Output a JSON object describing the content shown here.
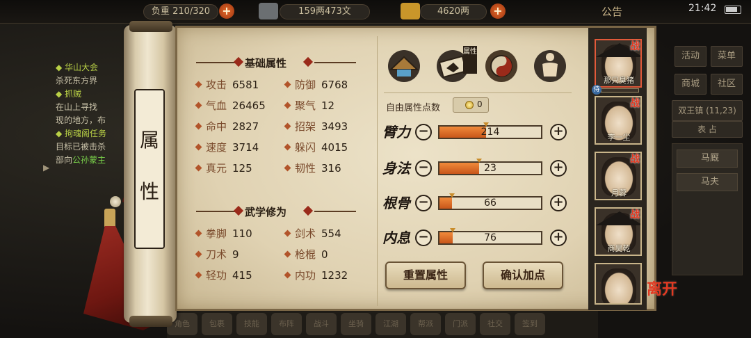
{
  "status": {
    "time": "21:42"
  },
  "topbar": {
    "carry_label": "负重",
    "carry": "210/320",
    "money_text": "159两473文",
    "gold": "4620两",
    "notice": "公告",
    "plus": "+"
  },
  "quest": {
    "items": [
      {
        "title": "华山大会",
        "desc": "杀死东方界"
      },
      {
        "title": "抓贼",
        "desc": "在山上寻找",
        "desc2": "现的地方，布"
      },
      {
        "title": "拘魂阁任务",
        "desc": "目标已被击杀",
        "desc2": "部向",
        "highlight": "公孙蒙主"
      }
    ]
  },
  "right_menu": {
    "buttons": [
      "活动",
      "菜单",
      "商城",
      "社区"
    ],
    "location": "双王镇",
    "coords": "(11,23)",
    "sub": "表 占",
    "items": [
      "马厩",
      "马夫"
    ]
  },
  "scroll_title": [
    "属",
    "性"
  ],
  "basic": {
    "title": "基础属性",
    "attrs": [
      {
        "name": "攻击",
        "value": "6581"
      },
      {
        "name": "防御",
        "value": "6768"
      },
      {
        "name": "气血",
        "value": "26465"
      },
      {
        "name": "聚气",
        "value": "12"
      },
      {
        "name": "命中",
        "value": "2827"
      },
      {
        "name": "招架",
        "value": "3493"
      },
      {
        "name": "速度",
        "value": "3714"
      },
      {
        "name": "躲闪",
        "value": "4015"
      },
      {
        "name": "真元",
        "value": "125"
      },
      {
        "name": "韧性",
        "value": "316"
      }
    ]
  },
  "martial": {
    "title": "武学修为",
    "attrs": [
      {
        "name": "拳脚",
        "value": "110"
      },
      {
        "name": "剑术",
        "value": "554"
      },
      {
        "name": "刀术",
        "value": "9"
      },
      {
        "name": "枪棍",
        "value": "0"
      },
      {
        "name": "轻功",
        "value": "415"
      },
      {
        "name": "内功",
        "value": "1232"
      }
    ]
  },
  "tabs": {
    "icons": [
      "hat-icon",
      "book-icon",
      "yinyang-icon",
      "meridian-body-icon"
    ],
    "selected_label": "属性"
  },
  "free_points": {
    "label": "自由属性点数",
    "value": "0"
  },
  "stats": [
    {
      "name": "臂力",
      "value": "214",
      "fill": 0.46
    },
    {
      "name": "身法",
      "value": "23",
      "fill": 0.39
    },
    {
      "name": "根骨",
      "value": "66",
      "fill": 0.12
    },
    {
      "name": "内息",
      "value": "76",
      "fill": 0.13
    }
  ],
  "controls": {
    "minus": "−",
    "plus": "+"
  },
  "buttons": {
    "reset": "重置属性",
    "confirm": "确认加点"
  },
  "party": {
    "members": [
      {
        "name": "那只臭猪",
        "active": true,
        "badge": "战",
        "tag": "侍"
      },
      {
        "name": "李一尘",
        "badge": "战"
      },
      {
        "name": "月蓉",
        "badge": "战"
      },
      {
        "name": "商昊乾",
        "badge": "战"
      },
      {
        "name": ""
      }
    ],
    "leave": "离开"
  },
  "bottom_bar": [
    "角色",
    "包裹",
    "技能",
    "布阵",
    "战斗",
    "坐骑",
    "江湖",
    "帮派",
    "门派",
    "社交",
    "签到"
  ],
  "colors": {
    "accent": "#e25a3a",
    "bar_fill": "#d8661e",
    "paper": "#e6dabd"
  }
}
